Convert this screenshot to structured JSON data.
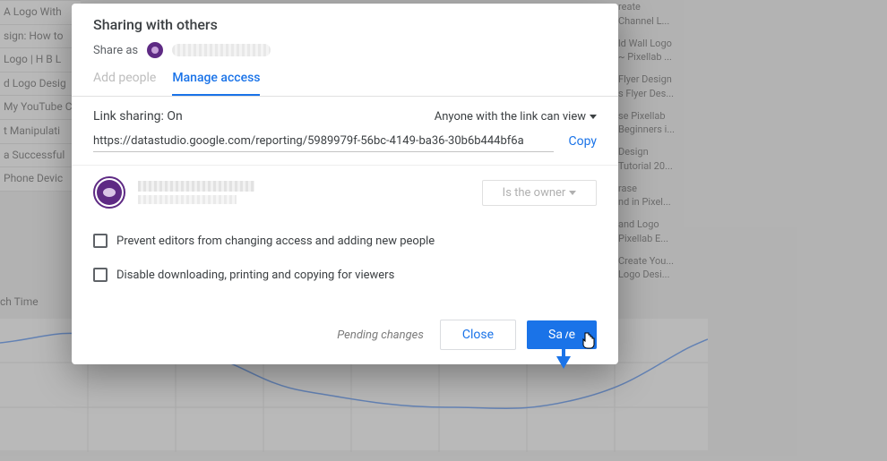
{
  "dialog": {
    "title": "Sharing with others",
    "share_as_label": "Share as",
    "tabs": {
      "add_people": "Add people",
      "manage_access": "Manage access"
    },
    "link": {
      "label": "Link sharing: On",
      "permission": "Anyone with the link can view",
      "url": "https://datastudio.google.com/reporting/5989979f-56bc-4149-ba36-30b6b444bf6a",
      "copy": "Copy"
    },
    "owner_role": "Is the owner",
    "opt_prevent": "Prevent editors from changing access and adding new people",
    "opt_disable": "Disable downloading, printing and copying for viewers",
    "pending": "Pending changes",
    "close": "Close",
    "save": "Save"
  },
  "bg_left": [
    "A Logo With",
    "sign: How to",
    "Logo | H B L",
    "d Logo Desig",
    "My YouTube C",
    "t Manipulati",
    "a Successful",
    "Phone Devic"
  ],
  "bg_right": [
    "reate",
    "Channel L...",
    "ld Wall Logo",
    "~ Pixellab ...",
    "Flyer Design",
    "s Flyer Des...",
    "se Pixellab",
    "Beginners i...",
    "Design",
    "Tutorial 20...",
    "rase",
    "nd in Pixel...",
    "and Logo",
    "Pixellab E...",
    "Create You...",
    "Logo Desi..."
  ],
  "bg_chart_label": "ch Time",
  "colors": {
    "primary": "#1a73e8",
    "text": "#3c4043",
    "muted": "#bdbdbd"
  }
}
